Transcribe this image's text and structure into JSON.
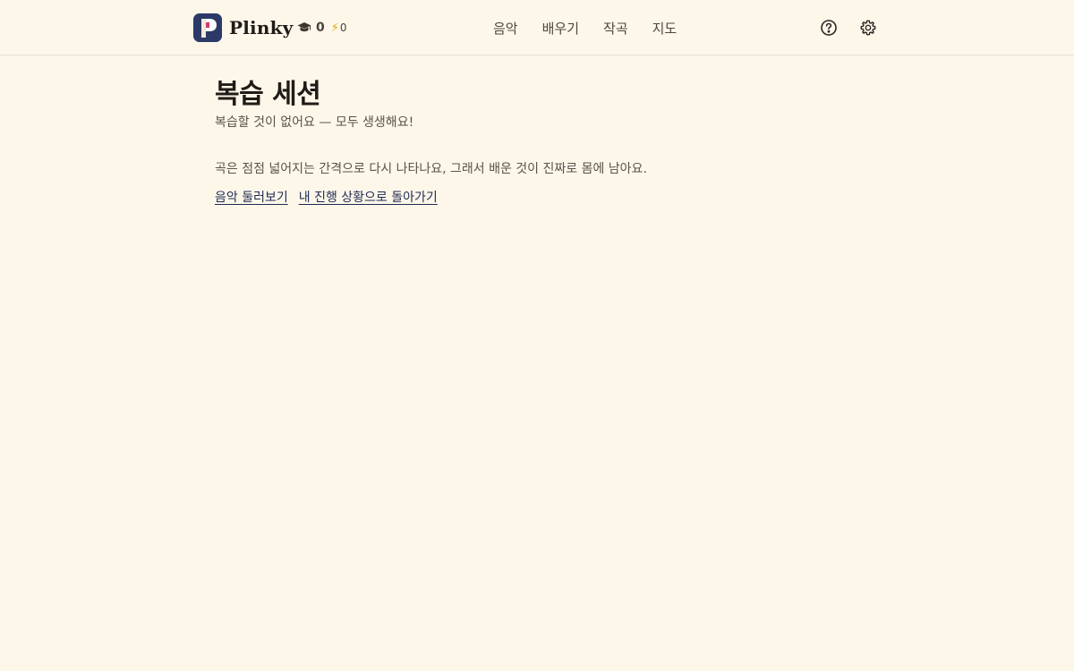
{
  "header": {
    "brand_name": "Plinky",
    "stats": {
      "graduated_count": "0",
      "bolt_count": "0"
    },
    "nav": [
      {
        "label": "음악"
      },
      {
        "label": "배우기"
      },
      {
        "label": "작곡"
      },
      {
        "label": "지도"
      }
    ],
    "icons": {
      "logo": "plinky-logo-icon",
      "graduated": "graduation-cap-icon",
      "bolt": "lightning-bolt-icon",
      "help": "help-circle-icon",
      "settings": "gear-icon"
    }
  },
  "main": {
    "title": "복습 세션",
    "subtitle": "복습할 것이 없어요 — 모두 생생해요!",
    "explanation": "곡은 점점 넓어지는 간격으로 다시 나타나요, 그래서 배운 것이 진짜로 몸에 남아요.",
    "links": {
      "browse_music": "음악 둘러보기",
      "back_to_progress": "내 진행 상황으로 돌아가기"
    }
  },
  "colors": {
    "background": "#fdf7ea",
    "logo_navy": "#2b3a67",
    "logo_pink": "#d6357a",
    "link": "#1e2a52",
    "bolt": "#e0a400"
  }
}
